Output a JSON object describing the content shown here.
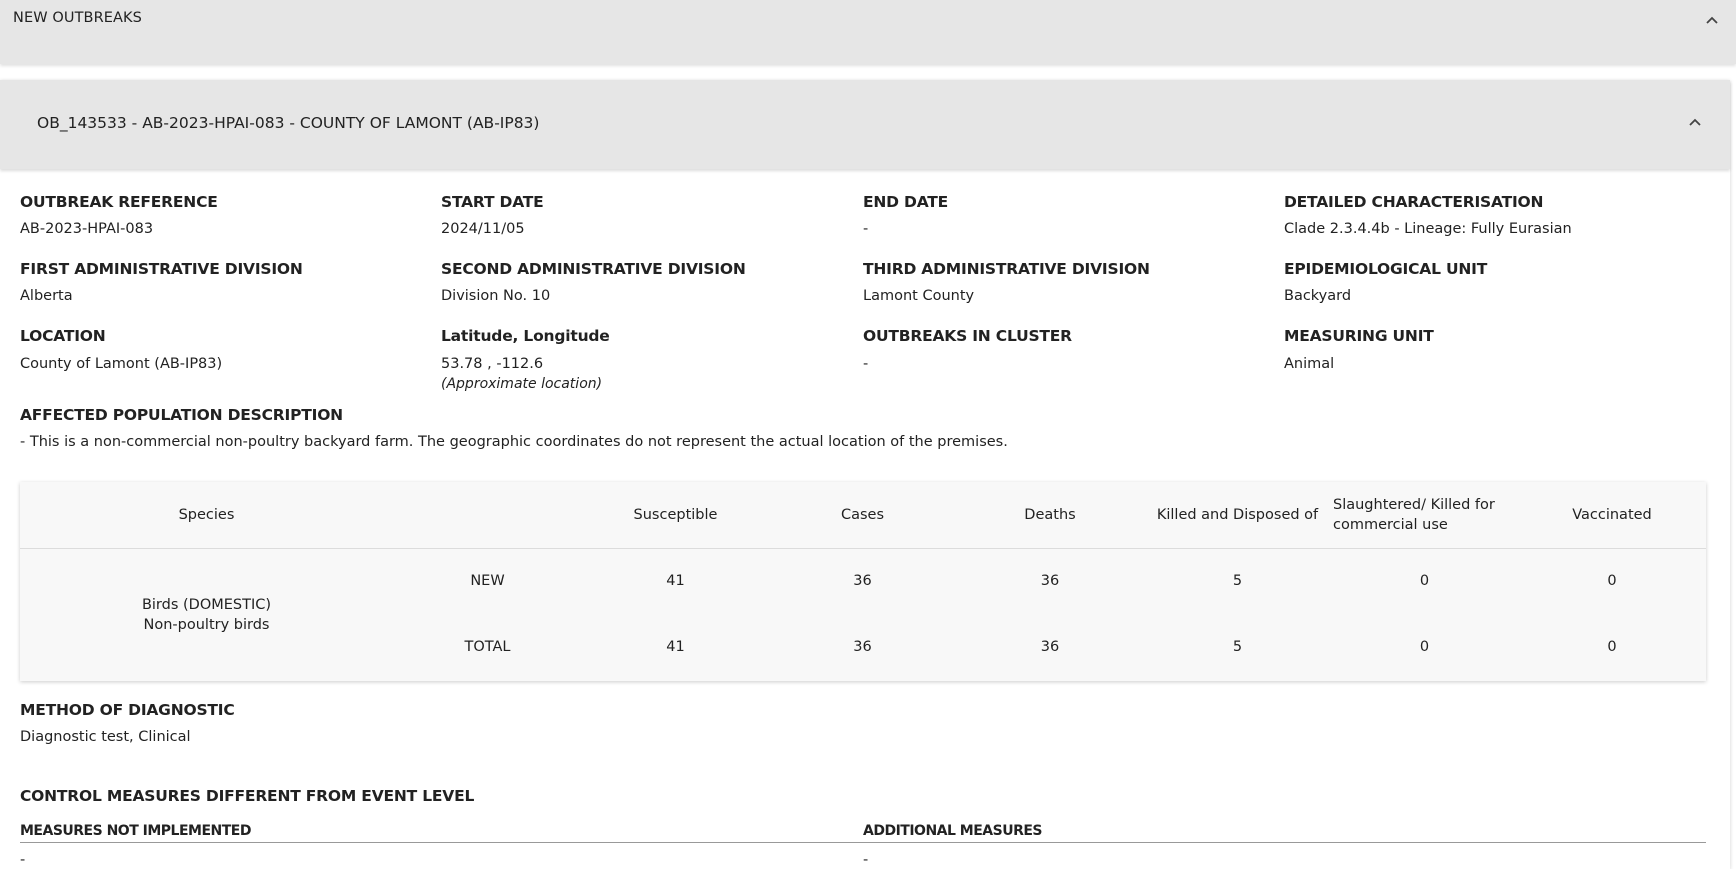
{
  "top_section": {
    "title": "NEW OUTBREAKS"
  },
  "outbreak": {
    "title": "OB_143533 - AB-2023-HPAI-083 - COUNTY OF LAMONT (AB-IP83)",
    "fields": {
      "outbreak_reference": {
        "label": "OUTBREAK REFERENCE",
        "value": "AB-2023-HPAI-083"
      },
      "start_date": {
        "label": "START DATE",
        "value": "2024/11/05"
      },
      "end_date": {
        "label": "END DATE",
        "value": "-"
      },
      "detailed_characterisation": {
        "label": "DETAILED CHARACTERISATION",
        "value": "Clade 2.3.4.4b - Lineage: Fully Eurasian"
      },
      "first_admin_division": {
        "label": "FIRST ADMINISTRATIVE DIVISION",
        "value": "Alberta"
      },
      "second_admin_division": {
        "label": "SECOND ADMINISTRATIVE DIVISION",
        "value": "Division No. 10"
      },
      "third_admin_division": {
        "label": "THIRD ADMINISTRATIVE DIVISION",
        "value": "Lamont County"
      },
      "epidemiological_unit": {
        "label": "EPIDEMIOLOGICAL UNIT",
        "value": "Backyard"
      },
      "location": {
        "label": "LOCATION",
        "value": "County of Lamont (AB-IP83)"
      },
      "lat_long": {
        "label": "Latitude, Longitude",
        "value": "53.78 , -112.6",
        "note": "(Approximate location)"
      },
      "outbreaks_in_cluster": {
        "label": "OUTBREAKS IN CLUSTER",
        "value": "-"
      },
      "measuring_unit": {
        "label": "MEASURING UNIT",
        "value": "Animal"
      },
      "affected_population": {
        "label": "AFFECTED POPULATION DESCRIPTION",
        "value": "- This is a non-commercial non-poultry backyard farm. The geographic coordinates do not represent the actual location of the premises."
      }
    },
    "table": {
      "headers": {
        "species": "Species",
        "susceptible": "Susceptible",
        "cases": "Cases",
        "deaths": "Deaths",
        "killed": "Killed and Disposed of",
        "slaughtered": "Slaughtered/ Killed for commercial use",
        "vaccinated": "Vaccinated"
      },
      "species_line1": "Birds (DOMESTIC)",
      "species_line2": "Non-poultry birds",
      "rows": [
        {
          "type": "NEW",
          "susceptible": "41",
          "cases": "36",
          "deaths": "36",
          "killed": "5",
          "slaughtered": "0",
          "vaccinated": "0"
        },
        {
          "type": "TOTAL",
          "susceptible": "41",
          "cases": "36",
          "deaths": "36",
          "killed": "5",
          "slaughtered": "0",
          "vaccinated": "0"
        }
      ]
    },
    "method_of_diagnostic": {
      "label": "METHOD OF DIAGNOSTIC",
      "value": "Diagnostic test, Clinical"
    },
    "control_measures": {
      "label": "CONTROL MEASURES DIFFERENT FROM EVENT LEVEL",
      "not_implemented_label": "MEASURES NOT IMPLEMENTED",
      "additional_label": "ADDITIONAL MEASURES",
      "not_implemented_value": "-",
      "additional_value": "-"
    }
  }
}
